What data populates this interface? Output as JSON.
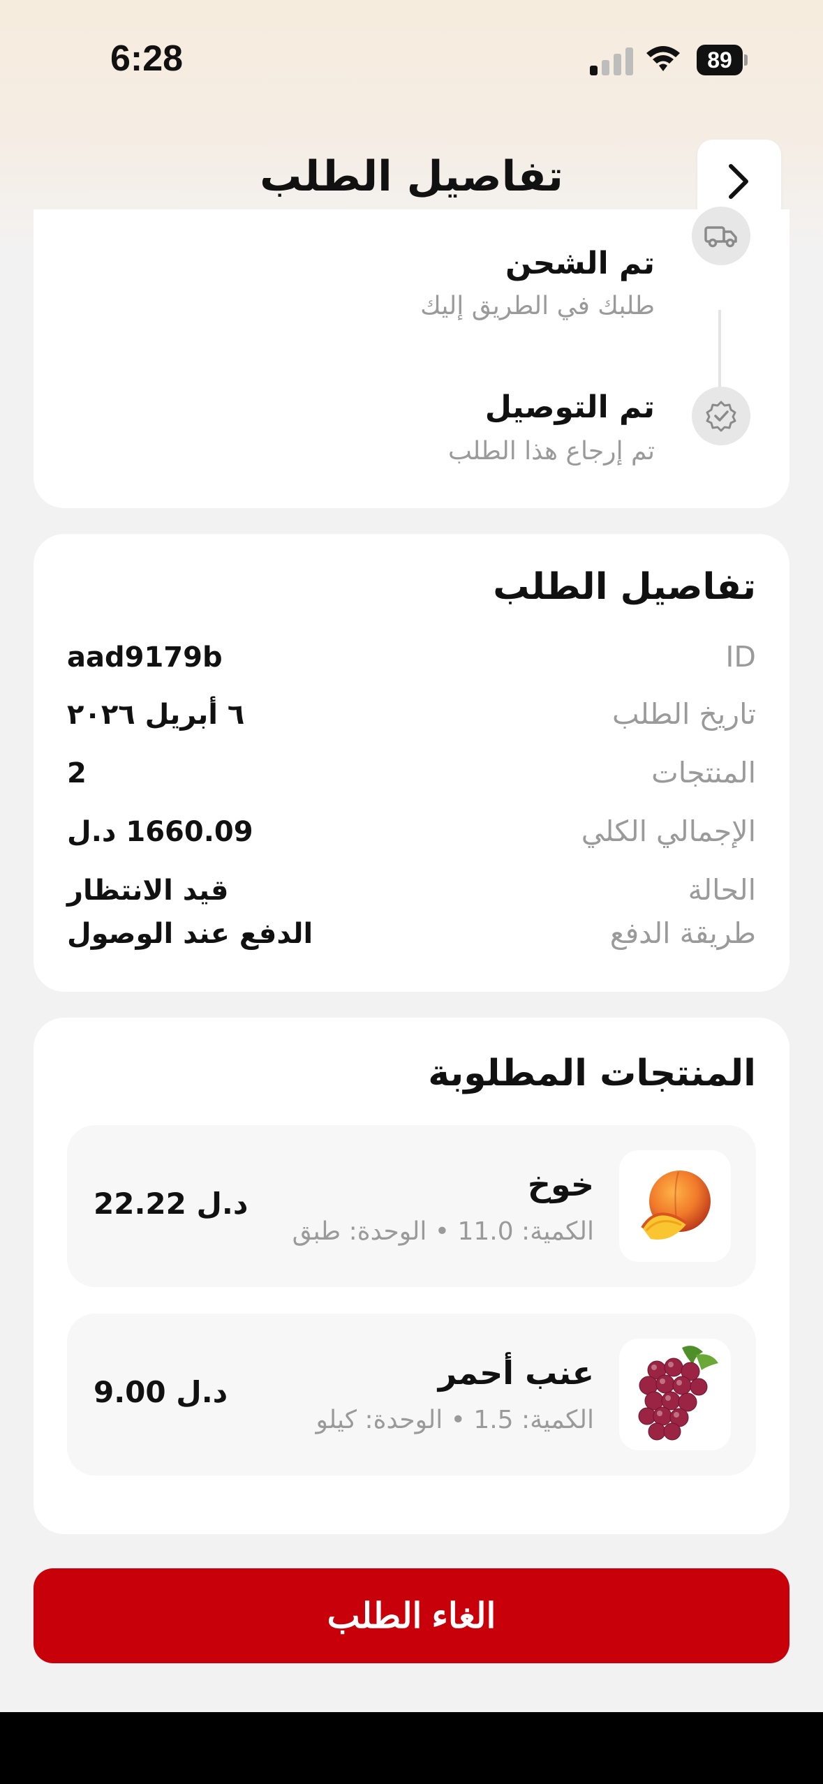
{
  "status_bar": {
    "time": "6:28",
    "battery": "89"
  },
  "header": {
    "title": "تفاصيل الطلب",
    "back_icon": "chevron-right-icon"
  },
  "timeline": {
    "steps": [
      {
        "title": "تم الشحن",
        "subtitle": "طلبك في الطريق إليك",
        "icon": "truck-icon"
      },
      {
        "title": "تم التوصيل",
        "subtitle": "تم إرجاع هذا الطلب",
        "icon": "verified-badge-icon"
      }
    ]
  },
  "order_details": {
    "title": "تفاصيل الطلب",
    "rows": [
      {
        "label": "ID",
        "value": "aad9179b"
      },
      {
        "label": "تاريخ الطلب",
        "value": "٦ أبريل ٢٠٢٦"
      },
      {
        "label": "المنتجات",
        "value": "2"
      },
      {
        "label": "الإجمالي الكلي",
        "value": "1660.09 د.ل"
      },
      {
        "label": "الحالة",
        "value": "قيد الانتظار"
      },
      {
        "label": "طريقة الدفع",
        "value": "الدفع عند الوصول"
      }
    ]
  },
  "products": {
    "title": "المنتجات المطلوبة",
    "items": [
      {
        "name": "خوخ",
        "meta": "الكمية: 11.0 • الوحدة: طبق",
        "price": "22.22 د.ل",
        "image": "peach-image"
      },
      {
        "name": "عنب أحمر",
        "meta": "الكمية: 1.5 • الوحدة: كيلو",
        "price": "9.00 د.ل",
        "image": "red-grapes-image"
      }
    ]
  },
  "actions": {
    "cancel_label": "الغاء الطلب"
  },
  "colors": {
    "accent": "#c8000a",
    "muted_text": "#9a9a9a",
    "background": "#f3f2f2"
  }
}
